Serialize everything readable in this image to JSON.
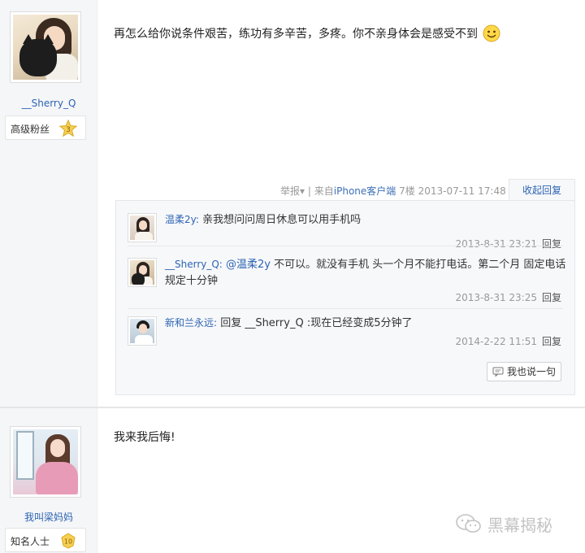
{
  "posts": [
    {
      "username": "__Sherry_Q",
      "badge": {
        "label": "高级粉丝",
        "level": "3"
      },
      "text": "再怎么给你说条件艰苦，练功有多辛苦，多疼。你不亲身体会是感受不到",
      "emoji": "smiley-face",
      "meta": {
        "report": "举报",
        "report_caret": "▾",
        "divider": "|",
        "source_prefix": "来自",
        "source": "iPhone客户端",
        "floor": "7楼",
        "datetime": "2013-07-11 17:48",
        "collapse": "收起回复"
      },
      "replies": [
        {
          "name": "温柔2y:",
          "text": "亲我想问问周日休息可以用手机吗",
          "datetime": "2013-8-31 23:21",
          "reply_label": "回复"
        },
        {
          "name": "__Sherry_Q:",
          "mention": "@温柔2y",
          "text": "不可以。就没有手机 头一个月不能打电话。第二个月 固定电话规定十分钟",
          "datetime": "2013-8-31 23:25",
          "reply_label": "回复"
        },
        {
          "name": "新和兰永远:",
          "text": "回复 __Sherry_Q :现在已经变成5分钟了",
          "datetime": "2014-2-22 11:51",
          "reply_label": "回复"
        }
      ],
      "say_button": "我也说一句"
    },
    {
      "username": "我叫梁妈妈",
      "badge": {
        "label": "知名人士",
        "level": "10"
      },
      "text": "我来我后悔!"
    }
  ],
  "watermark": "黑幕揭秘",
  "colors": {
    "link": "#2d64b3",
    "meta": "#999999",
    "badge_gold": "#f2c233"
  }
}
